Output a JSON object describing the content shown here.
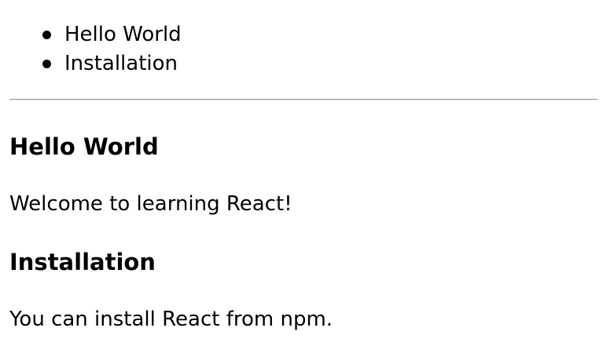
{
  "nav": {
    "items": [
      {
        "label": "Hello World"
      },
      {
        "label": "Installation"
      }
    ]
  },
  "sections": [
    {
      "title": "Hello World",
      "content": "Welcome to learning React!"
    },
    {
      "title": "Installation",
      "content": "You can install React from npm."
    }
  ]
}
